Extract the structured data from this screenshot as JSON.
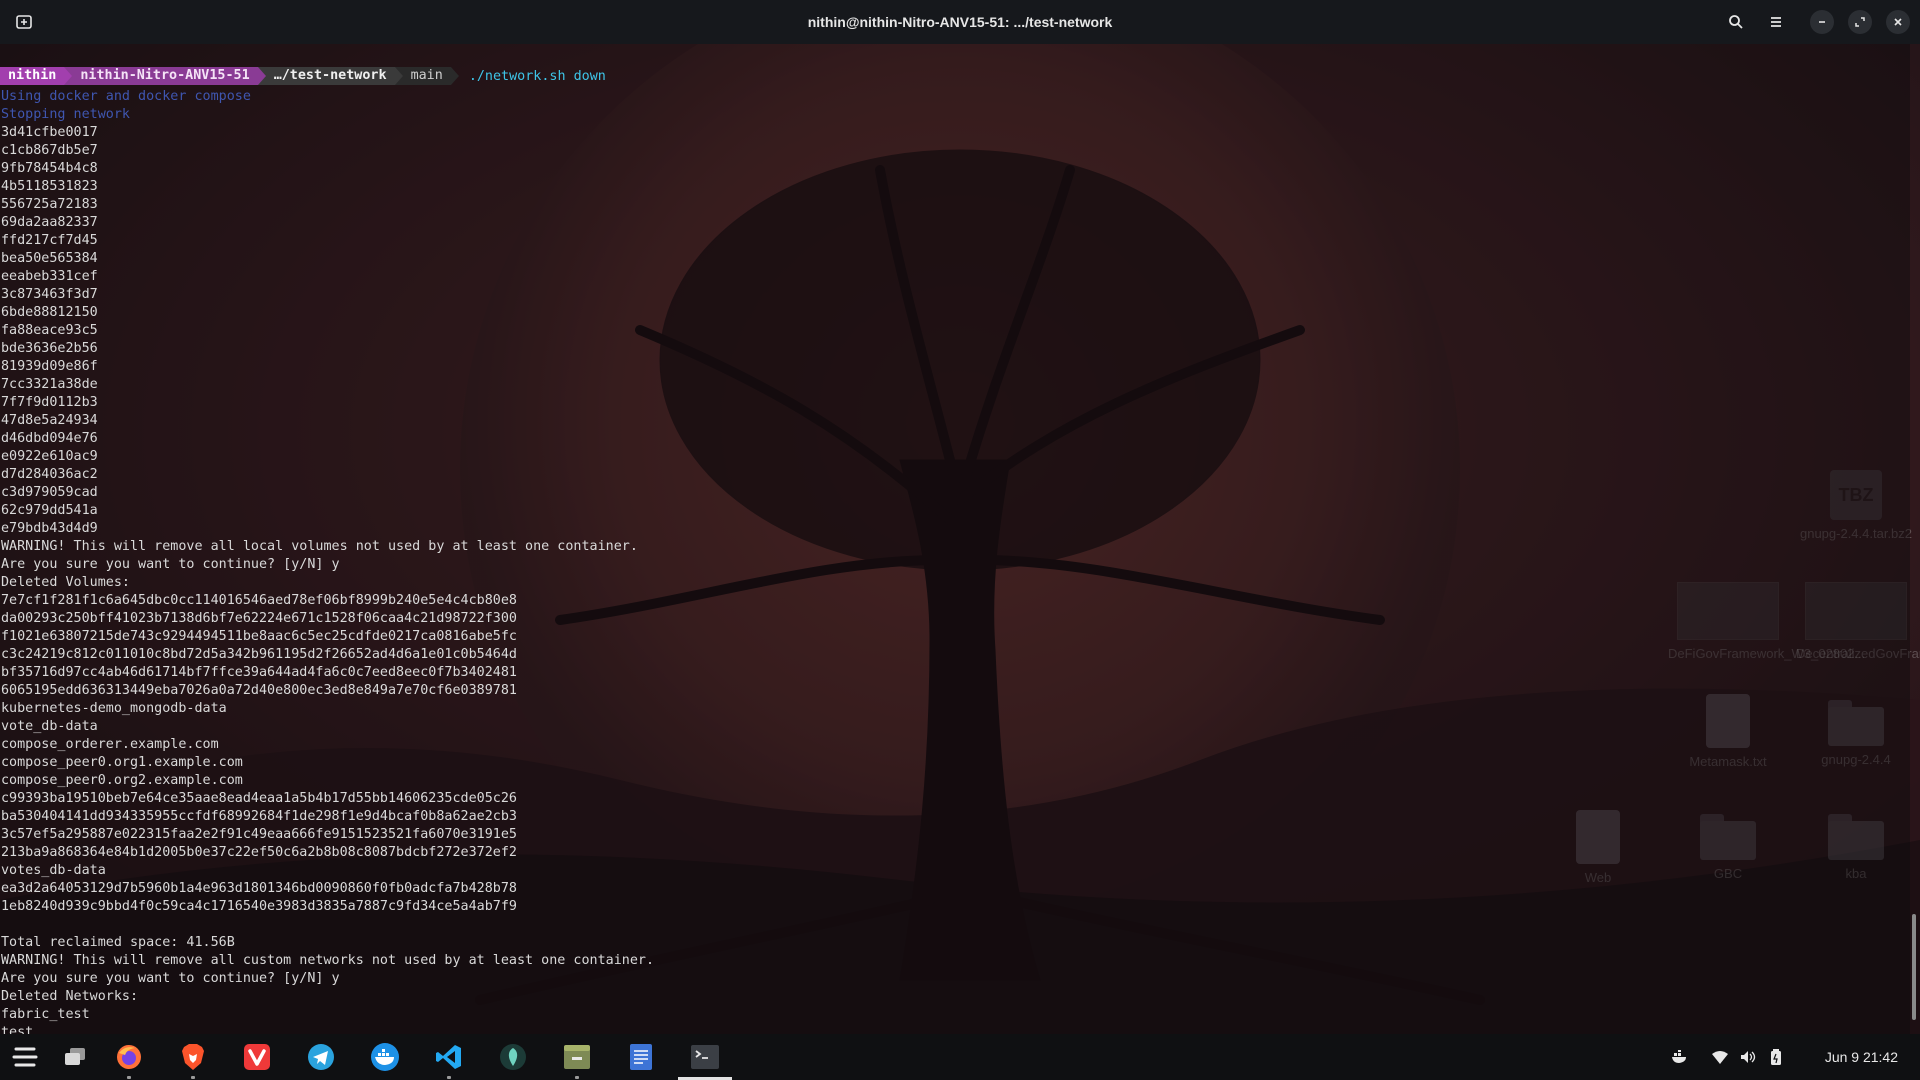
{
  "window": {
    "title": "nithin@nithin-Nitro-ANV15-51: .../test-network"
  },
  "prompt": {
    "user": "nithin",
    "host": "nithin-Nitro-ANV15-51",
    "directory": "…/test-network",
    "git_branch": "main",
    "command": "./network.sh down"
  },
  "terminal_lines": [
    {
      "text": "Using docker and docker compose",
      "style": "info"
    },
    {
      "text": "Stopping network",
      "style": "info"
    },
    {
      "text": "3d41cfbe0017",
      "style": "normal"
    },
    {
      "text": "c1cb867db5e7",
      "style": "normal"
    },
    {
      "text": "9fb78454b4c8",
      "style": "normal"
    },
    {
      "text": "4b5118531823",
      "style": "normal"
    },
    {
      "text": "556725a72183",
      "style": "normal"
    },
    {
      "text": "69da2aa82337",
      "style": "normal"
    },
    {
      "text": "ffd217cf7d45",
      "style": "normal"
    },
    {
      "text": "bea50e565384",
      "style": "normal"
    },
    {
      "text": "eeabeb331cef",
      "style": "normal"
    },
    {
      "text": "3c873463f3d7",
      "style": "normal"
    },
    {
      "text": "6bde88812150",
      "style": "normal"
    },
    {
      "text": "fa88eace93c5",
      "style": "normal"
    },
    {
      "text": "bde3636e2b56",
      "style": "normal"
    },
    {
      "text": "81939d09e86f",
      "style": "normal"
    },
    {
      "text": "7cc3321a38de",
      "style": "normal"
    },
    {
      "text": "7f7f9d0112b3",
      "style": "normal"
    },
    {
      "text": "47d8e5a24934",
      "style": "normal"
    },
    {
      "text": "d46dbd094e76",
      "style": "normal"
    },
    {
      "text": "e0922e610ac9",
      "style": "normal"
    },
    {
      "text": "d7d284036ac2",
      "style": "normal"
    },
    {
      "text": "c3d979059cad",
      "style": "normal"
    },
    {
      "text": "62c979dd541a",
      "style": "normal"
    },
    {
      "text": "e79bdb43d4d9",
      "style": "normal"
    },
    {
      "text": "WARNING! This will remove all local volumes not used by at least one container.",
      "style": "normal"
    },
    {
      "text": "Are you sure you want to continue? [y/N] y",
      "style": "normal"
    },
    {
      "text": "Deleted Volumes:",
      "style": "normal"
    },
    {
      "text": "7e7cf1f281f1c6a645dbc0cc114016546aed78ef06bf8999b240e5e4c4cb80e8",
      "style": "normal"
    },
    {
      "text": "da00293c250bff41023b7138d6bf7e62224e671c1528f06caa4c21d98722f300",
      "style": "normal"
    },
    {
      "text": "f1021e63807215de743c9294494511be8aac6c5ec25cdfde0217ca0816abe5fc",
      "style": "normal"
    },
    {
      "text": "c3c24219c812c011010c8bd72d5a342b961195d2f26652ad4d6a1e01c0b5464d",
      "style": "normal"
    },
    {
      "text": "bf35716d97cc4ab46d61714bf7ffce39a644ad4fa6c0c7eed8eec0f7b3402481",
      "style": "normal"
    },
    {
      "text": "6065195edd636313449eba7026a0a72d40e800ec3ed8e849a7e70cf6e0389781",
      "style": "normal"
    },
    {
      "text": "kubernetes-demo_mongodb-data",
      "style": "normal"
    },
    {
      "text": "vote_db-data",
      "style": "normal"
    },
    {
      "text": "compose_orderer.example.com",
      "style": "normal"
    },
    {
      "text": "compose_peer0.org1.example.com",
      "style": "normal"
    },
    {
      "text": "compose_peer0.org2.example.com",
      "style": "normal"
    },
    {
      "text": "c99393ba19510beb7e64ce35aae8ead4eaa1a5b4b17d55bb14606235cde05c26",
      "style": "normal"
    },
    {
      "text": "ba530404141dd934335955ccfdf68992684f1de298f1e9d4bcaf0b8a62ae2cb3",
      "style": "normal"
    },
    {
      "text": "3c57ef5a295887e022315faa2e2f91c49eaa666fe9151523521fa6070e3191e5",
      "style": "normal"
    },
    {
      "text": "213ba9a868364e84b1d2005b0e37c22ef50c6a2b8b08c8087bdcbf272e372ef2",
      "style": "normal"
    },
    {
      "text": "votes_db-data",
      "style": "normal"
    },
    {
      "text": "ea3d2a64053129d7b5960b1a4e963d1801346bd0090860f0fb0adcfa7b428b78",
      "style": "normal"
    },
    {
      "text": "1eb8240d939c9bbd4f0c59ca4c1716540e3983d3835a7887c9fd34ce5a4ab7f9",
      "style": "normal"
    },
    {
      "text": "",
      "style": "normal"
    },
    {
      "text": "Total reclaimed space: 41.56B",
      "style": "normal"
    },
    {
      "text": "WARNING! This will remove all custom networks not used by at least one container.",
      "style": "normal"
    },
    {
      "text": "Are you sure you want to continue? [y/N] y",
      "style": "normal"
    },
    {
      "text": "Deleted Networks:",
      "style": "normal"
    },
    {
      "text": "fabric_test",
      "style": "normal"
    },
    {
      "text": "test",
      "style": "normal"
    }
  ],
  "desktop_icons": [
    {
      "label": "gnupg-2.4.4.tar.bz2",
      "kind": "archive-icon"
    },
    {
      "label": "DeFiGovFramework_W3_02802...",
      "kind": "thumbnail-icon"
    },
    {
      "label": "DecentralizedGovFramework_W...",
      "kind": "thumbnail-icon"
    },
    {
      "label": "Metamask.txt",
      "kind": "text-file-icon"
    },
    {
      "label": "gnupg-2.4.4",
      "kind": "folder-icon"
    },
    {
      "label": "Web",
      "kind": "file-icon"
    },
    {
      "label": "GBC",
      "kind": "folder-icon"
    },
    {
      "label": "kba",
      "kind": "folder-icon"
    }
  ],
  "taskbar": {
    "apps": [
      "zorin-menu-icon",
      "workspaces-icon",
      "firefox-icon",
      "brave-icon",
      "vivaldi-icon",
      "telegram-icon",
      "docker-icon",
      "vscode-icon",
      "app-icon",
      "files-icon",
      "text-editor-icon",
      "terminal-icon"
    ],
    "tray": [
      "docker-tray-icon",
      "wifi-icon",
      "volume-icon",
      "battery-icon"
    ],
    "clock": "Jun 9  21:42"
  },
  "colors": {
    "prompt_user_bg": "#a23fae",
    "prompt_host_bg": "#8a3b95",
    "command_text": "#3ec5e8",
    "info_text": "#3f56b0"
  }
}
